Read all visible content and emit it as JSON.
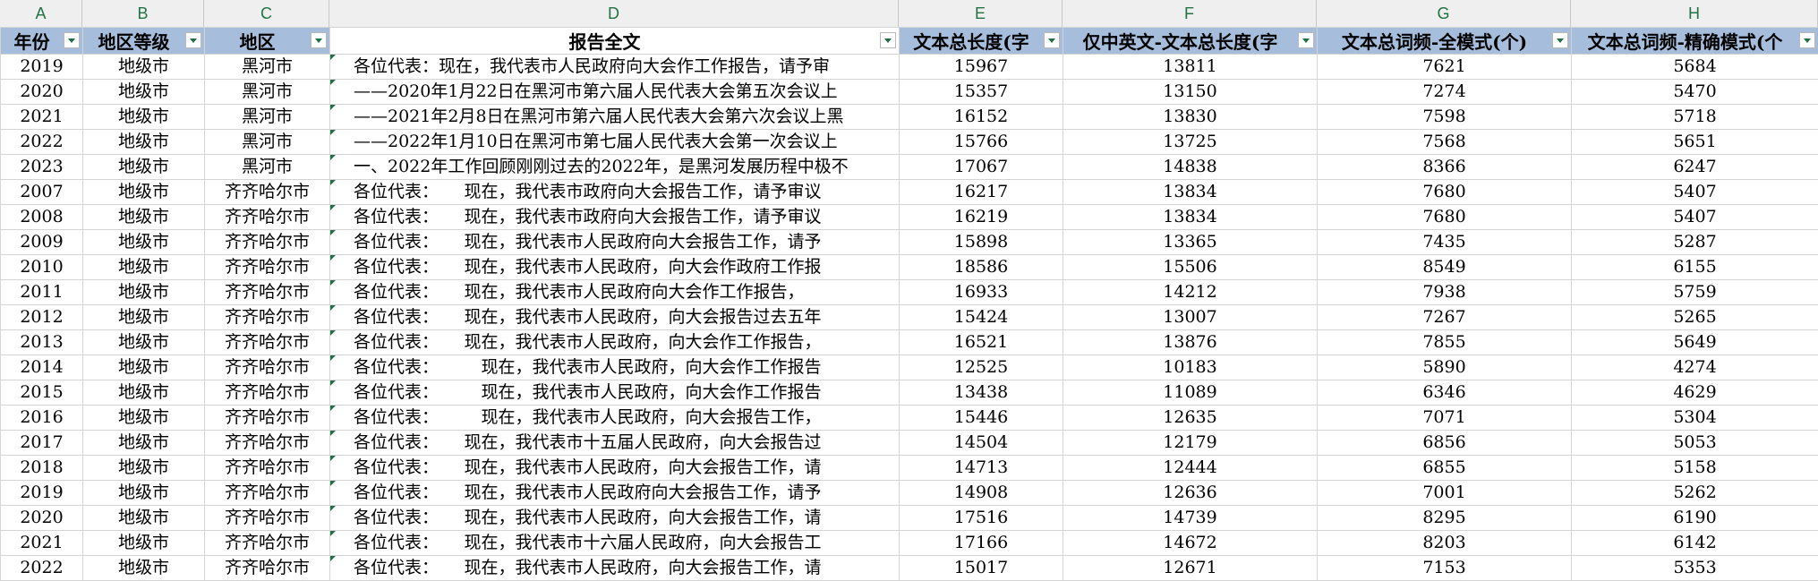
{
  "columns": [
    "A",
    "B",
    "C",
    "D",
    "E",
    "F",
    "G",
    "H"
  ],
  "headers": [
    "年份",
    "地区等级",
    "地区",
    "报告全文",
    "文本总长度(字",
    "仅中英文-文本总长度(字",
    "文本总词频-全模式(个)",
    "文本总词频-精确模式(个"
  ],
  "rows": [
    [
      "2019",
      "地级市",
      "黑河市",
      "各位代表：现在，我代表市人民政府向大会作工作报告，请予审",
      "15967",
      "13811",
      "7621",
      "5684"
    ],
    [
      "2020",
      "地级市",
      "黑河市",
      "——2020年1月22日在黑河市第六届人民代表大会第五次会议上",
      "15357",
      "13150",
      "7274",
      "5470"
    ],
    [
      "2021",
      "地级市",
      "黑河市",
      "——2021年2月8日在黑河市第六届人民代表大会第六次会议上黑",
      "16152",
      "13830",
      "7598",
      "5718"
    ],
    [
      "2022",
      "地级市",
      "黑河市",
      "——2022年1月10日在黑河市第七届人民代表大会第一次会议上",
      "15766",
      "13725",
      "7568",
      "5651"
    ],
    [
      "2023",
      "地级市",
      "黑河市",
      "一、2022年工作回顾刚刚过去的2022年，是黑河发展历程中极不",
      "17067",
      "14838",
      "8366",
      "6247"
    ],
    [
      "2007",
      "地级市",
      "齐齐哈尔市",
      "各位代表：　　现在，我代表市政府向大会报告工作，请予审议",
      "16217",
      "13834",
      "7680",
      "5407"
    ],
    [
      "2008",
      "地级市",
      "齐齐哈尔市",
      "各位代表：　　现在，我代表市政府向大会报告工作，请予审议",
      "16219",
      "13834",
      "7680",
      "5407"
    ],
    [
      "2009",
      "地级市",
      "齐齐哈尔市",
      "各位代表：　　现在，我代表市人民政府向大会报告工作，请予",
      "15898",
      "13365",
      "7435",
      "5287"
    ],
    [
      "2010",
      "地级市",
      "齐齐哈尔市",
      "各位代表：　　现在，我代表市人民政府，向大会作政府工作报",
      "18586",
      "15506",
      "8549",
      "6155"
    ],
    [
      "2011",
      "地级市",
      "齐齐哈尔市",
      "各位代表：　　现在，我代表市人民政府向大会作工作报告，",
      "16933",
      "14212",
      "7938",
      "5759"
    ],
    [
      "2012",
      "地级市",
      "齐齐哈尔市",
      "各位代表：　　现在，我代表市人民政府，向大会报告过去五年",
      "15424",
      "13007",
      "7267",
      "5265"
    ],
    [
      "2013",
      "地级市",
      "齐齐哈尔市",
      "各位代表：　　现在，我代表市人民政府，向大会作工作报告，",
      "16521",
      "13876",
      "7855",
      "5649"
    ],
    [
      "2014",
      "地级市",
      "齐齐哈尔市",
      "各位代表：　　　现在，我代表市人民政府，向大会作工作报告",
      "12525",
      "10183",
      "5890",
      "4274"
    ],
    [
      "2015",
      "地级市",
      "齐齐哈尔市",
      "各位代表：　　　现在，我代表市人民政府，向大会作工作报告",
      "13438",
      "11089",
      "6346",
      "4629"
    ],
    [
      "2016",
      "地级市",
      "齐齐哈尔市",
      "各位代表：　　　现在，我代表市人民政府，向大会报告工作，",
      "15446",
      "12635",
      "7071",
      "5304"
    ],
    [
      "2017",
      "地级市",
      "齐齐哈尔市",
      "各位代表：　　现在，我代表市十五届人民政府，向大会报告过",
      "14504",
      "12179",
      "6856",
      "5053"
    ],
    [
      "2018",
      "地级市",
      "齐齐哈尔市",
      "各位代表：　　现在，我代表市人民政府，向大会报告工作，请",
      "14713",
      "12444",
      "6855",
      "5158"
    ],
    [
      "2019",
      "地级市",
      "齐齐哈尔市",
      "各位代表：　　现在，我代表市人民政府向大会报告工作，请予",
      "14908",
      "12636",
      "7001",
      "5262"
    ],
    [
      "2020",
      "地级市",
      "齐齐哈尔市",
      "各位代表：　　现在，我代表市人民政府，向大会报告工作，请",
      "17516",
      "14739",
      "8295",
      "6190"
    ],
    [
      "2021",
      "地级市",
      "齐齐哈尔市",
      "各位代表：　　现在，我代表市十六届人民政府，向大会报告工",
      "17166",
      "14672",
      "8203",
      "6142"
    ],
    [
      "2022",
      "地级市",
      "齐齐哈尔市",
      "各位代表：　　现在，我代表市人民政府，向大会报告工作，请",
      "15017",
      "12671",
      "7153",
      "5353"
    ]
  ]
}
